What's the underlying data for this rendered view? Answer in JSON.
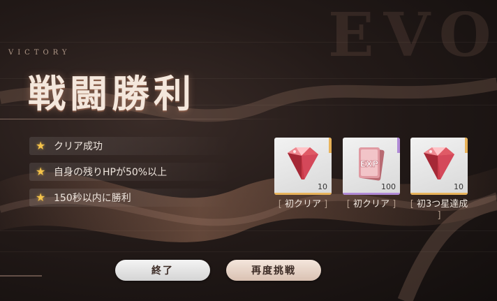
{
  "background": {
    "watermark": "EVO"
  },
  "header": {
    "victory": "VICTORY",
    "title": "戦闘勝利"
  },
  "objectives": [
    {
      "icon": "star-icon",
      "text": "クリア成功"
    },
    {
      "icon": "star-icon",
      "text": "自身の残りHPが50%以上"
    },
    {
      "icon": "star-icon",
      "text": "150秒以内に勝利"
    }
  ],
  "rewards": [
    {
      "icon": "red-gem-icon",
      "quantity": "10",
      "label": "初クリア",
      "rarity_color": "#e8b35a"
    },
    {
      "icon": "exp-card-icon",
      "icon_text": "EXP",
      "quantity": "100",
      "label": "初クリア",
      "rarity_color": "#b08ad6"
    },
    {
      "icon": "red-gem-icon",
      "quantity": "10",
      "label": "初3つ星達成",
      "rarity_color": "#e8b35a"
    }
  ],
  "buttons": {
    "end": "終了",
    "retry": "再度挑戦"
  },
  "colors": {
    "star": "#f5c34a",
    "gold_rarity": "#e8b35a",
    "purple_rarity": "#b08ad6"
  }
}
